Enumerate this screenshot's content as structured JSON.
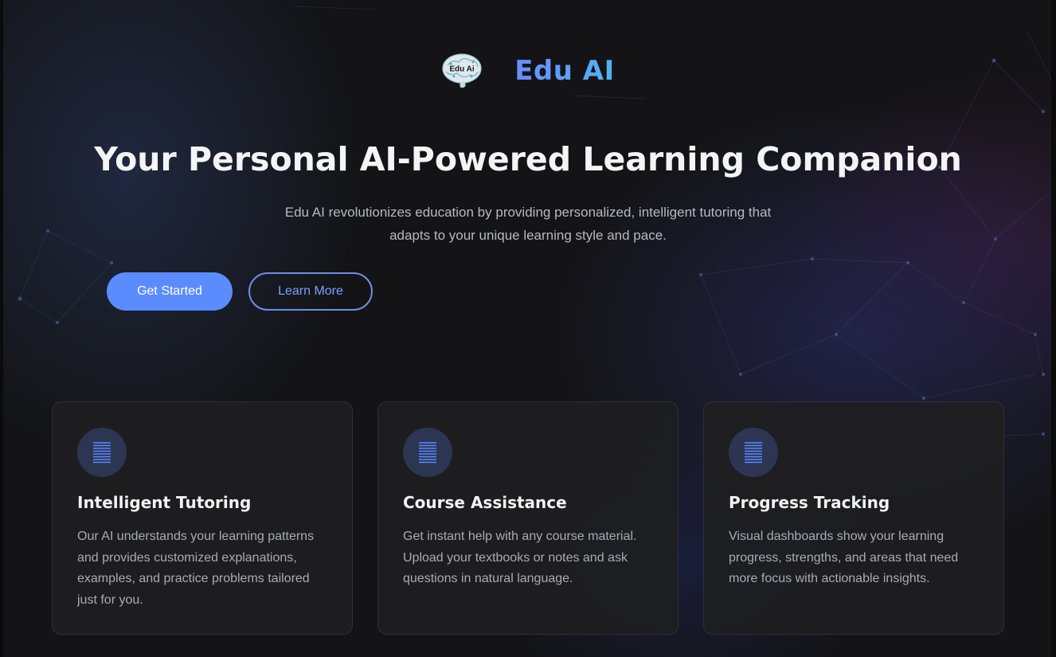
{
  "brand": {
    "logo_text": "Edu Ai",
    "name": "Edu AI"
  },
  "hero": {
    "headline": "Your Personal AI-Powered Learning Companion",
    "subtitle_line1": "Edu AI revolutionizes education by providing personalized, intelligent tutoring that",
    "subtitle_line2": "adapts to your unique learning style and pace.",
    "primary_button": "Get Started",
    "secondary_button": "Learn More"
  },
  "features": [
    {
      "icon": "document-lines-icon",
      "title": "Intelligent Tutoring",
      "description": "Our AI understands your learning patterns and provides customized explanations, examples, and practice problems tailored just for you."
    },
    {
      "icon": "document-lines-icon",
      "title": "Course Assistance",
      "description": "Get instant help with any course material. Upload your textbooks or notes and ask questions in natural language."
    },
    {
      "icon": "document-lines-icon",
      "title": "Progress Tracking",
      "description": "Visual dashboards show your learning progress, strengths, and areas that need more focus with actionable insights."
    }
  ],
  "colors": {
    "background": "#141416",
    "accent": "#5b8cff",
    "brand_gradient_start": "#6a8cff",
    "brand_gradient_end": "#4fb2f5",
    "card_background": "#1e1e21",
    "icon_circle": "#2c3552"
  }
}
